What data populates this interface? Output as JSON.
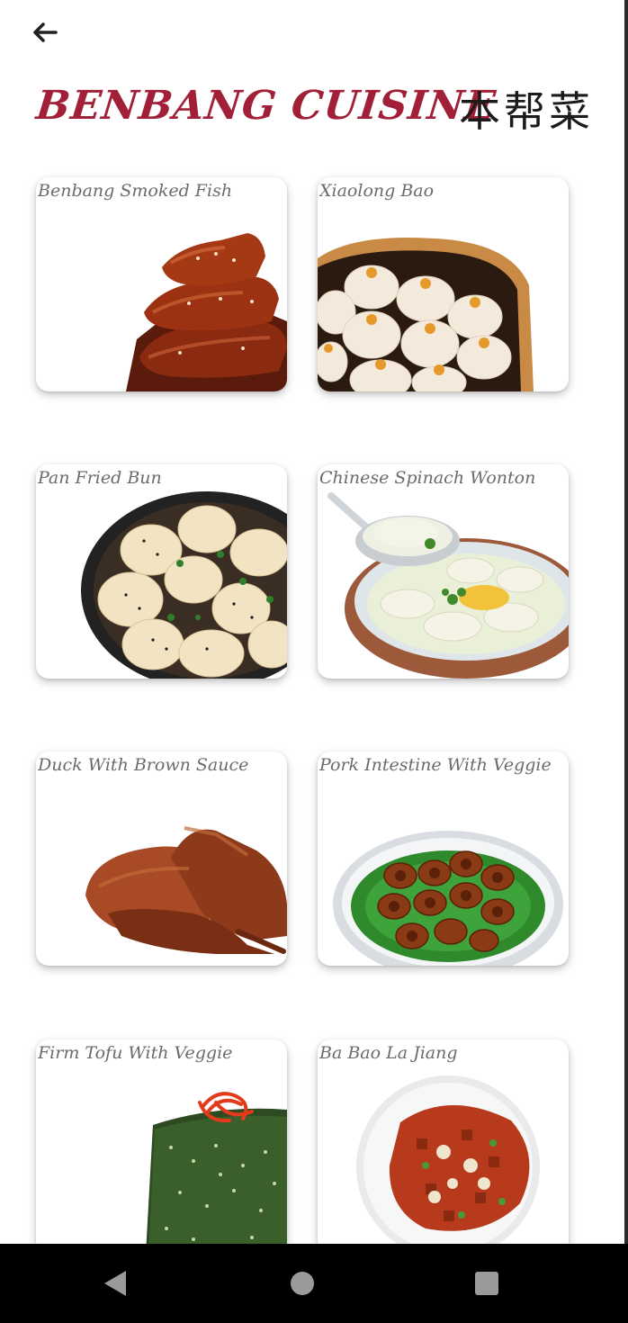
{
  "header": {
    "back_icon": "arrow-left-icon",
    "title": "BENBANG CUISINE",
    "title_cn": "本帮菜",
    "title_color": "#a11f37"
  },
  "dishes": [
    {
      "label": "Benbang Smoked Fish"
    },
    {
      "label": "Xiaolong Bao"
    },
    {
      "label": "Pan Fried Bun"
    },
    {
      "label": "Chinese Spinach Wonton"
    },
    {
      "label": "Duck With Brown Sauce"
    },
    {
      "label": "Pork Intestine With Veggie"
    },
    {
      "label": "Firm Tofu With Veggie"
    },
    {
      "label": "Ba Bao La Jiang"
    }
  ],
  "system_nav": {
    "back_icon": "triangle-back-icon",
    "home_icon": "circle-home-icon",
    "recents_icon": "square-recents-icon"
  }
}
